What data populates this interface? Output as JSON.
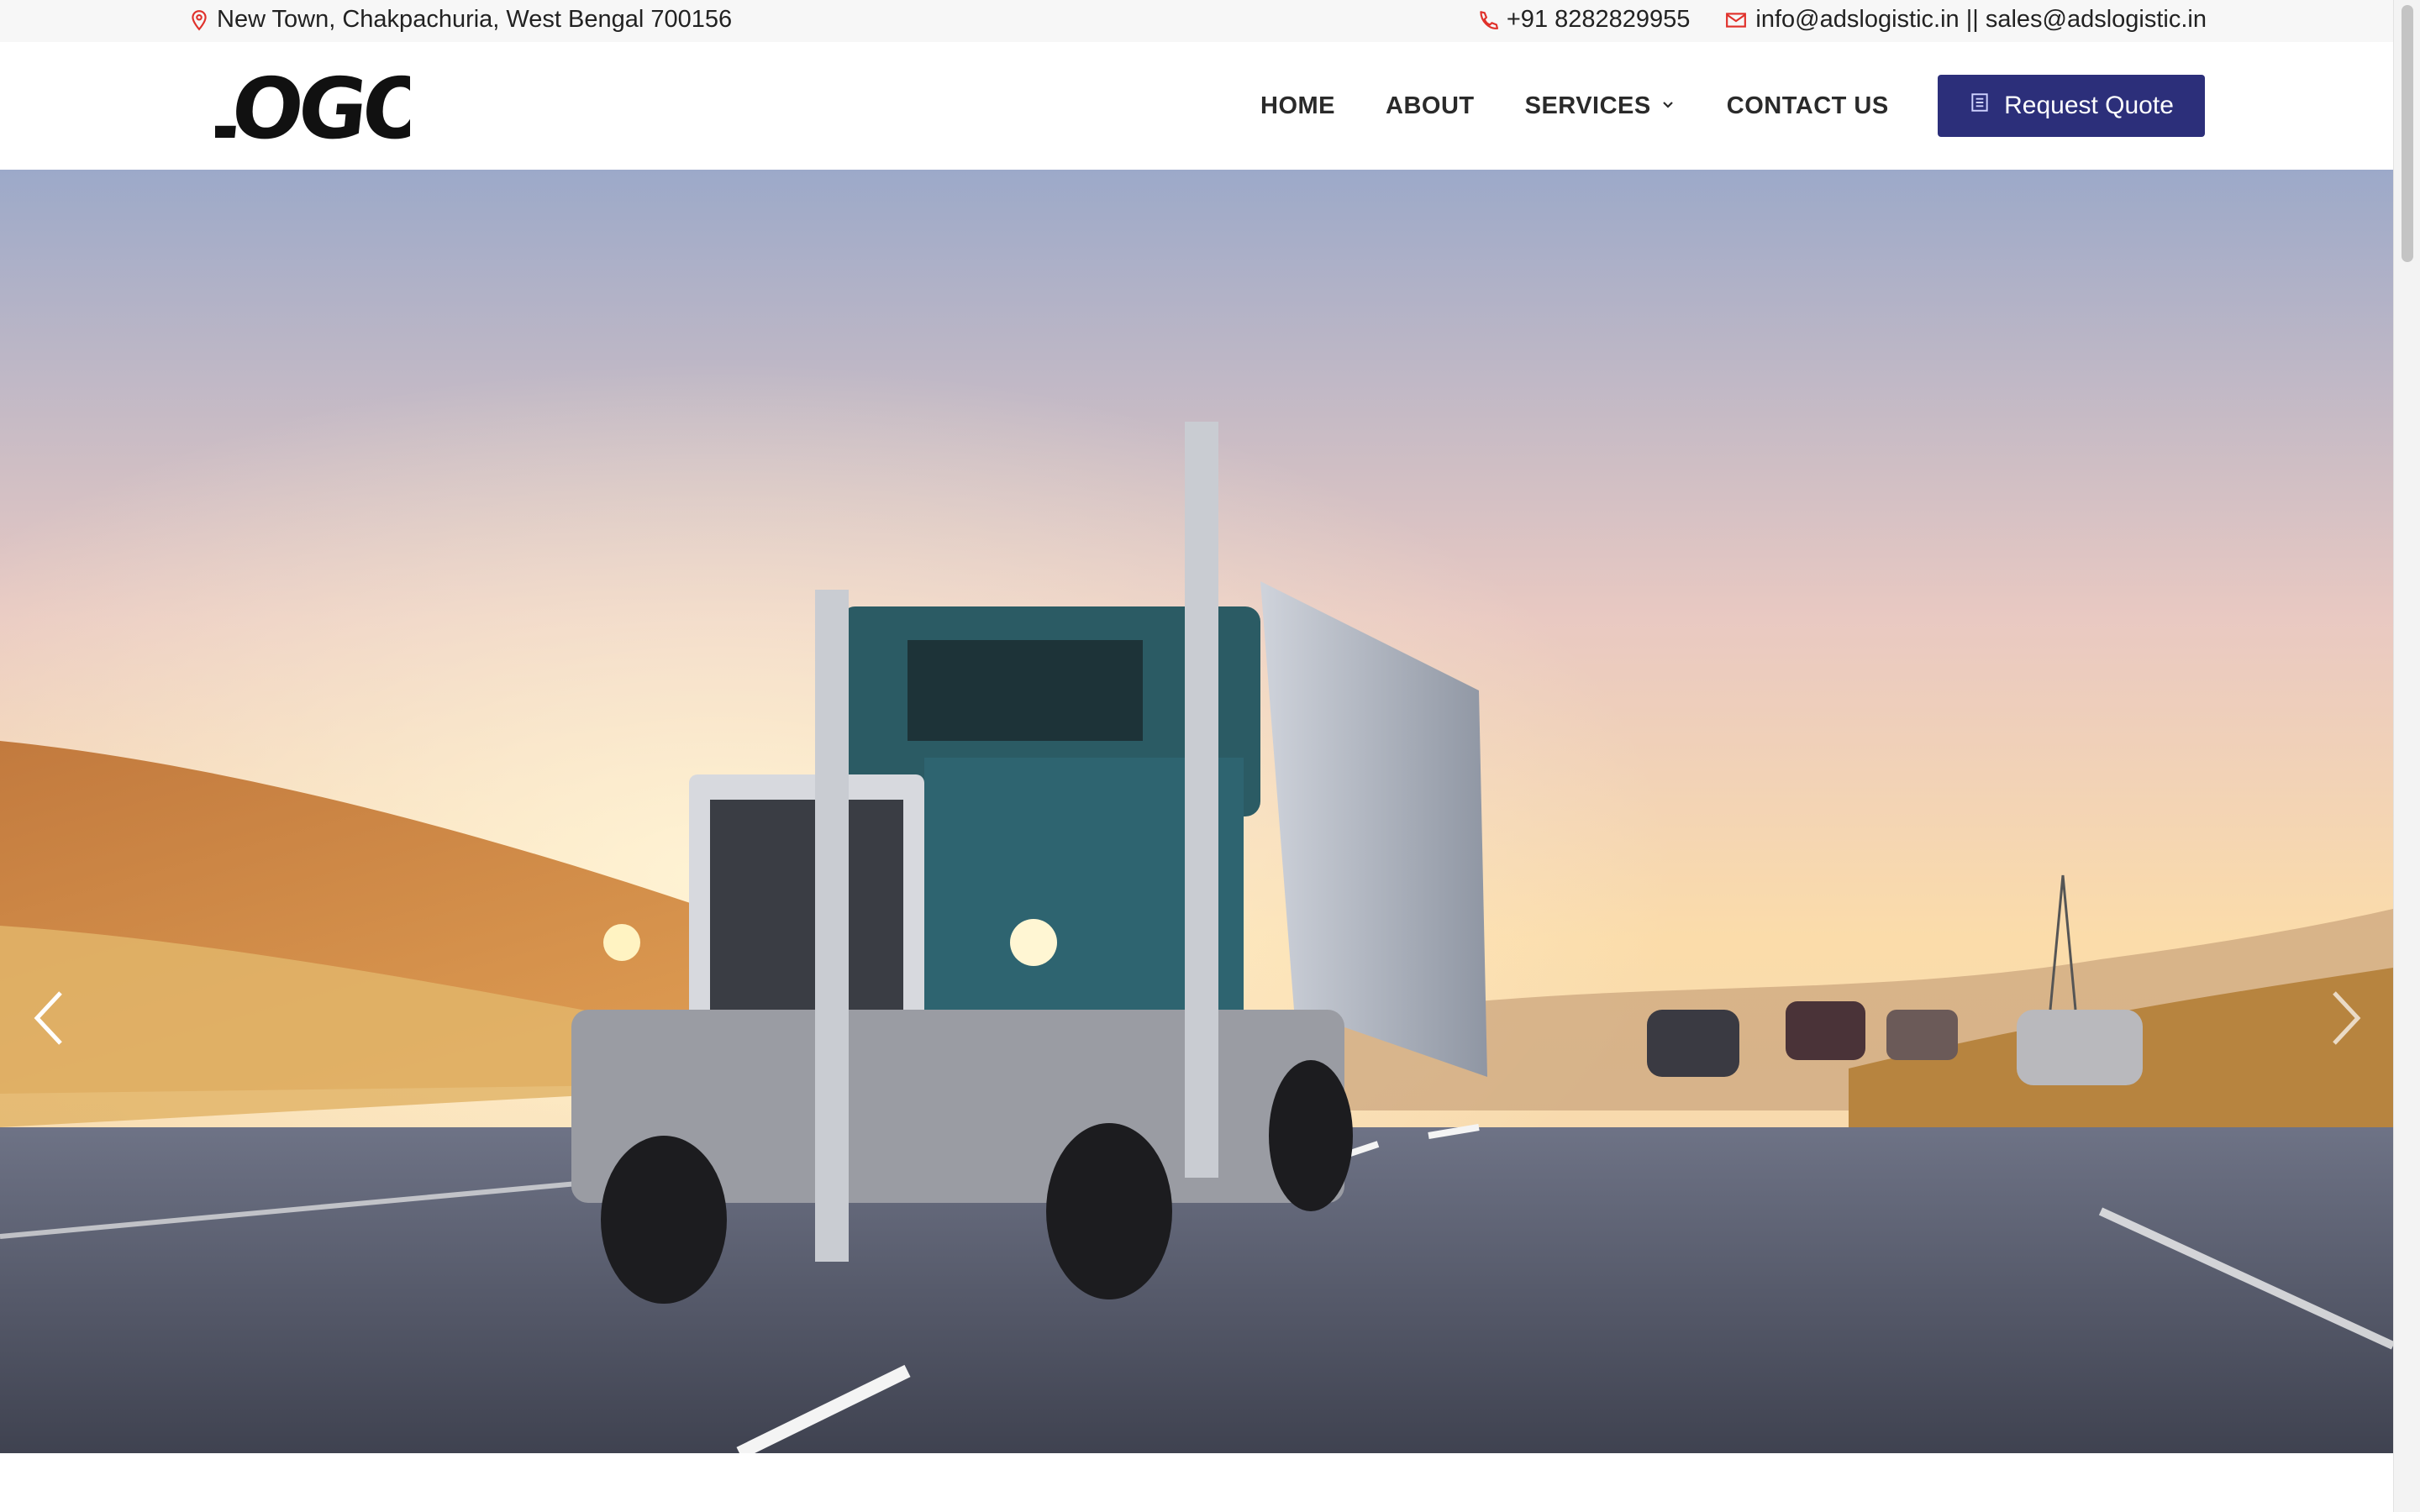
{
  "topbar": {
    "address": "New Town, Chakpachuria, West Bengal 700156",
    "phone": "+91 8282829955",
    "emails": "info@adslogistic.in || sales@adslogistic.in",
    "icons": [
      "location-icon",
      "phone-icon",
      "mail-icon"
    ],
    "icon_color": "#e0312b"
  },
  "header": {
    "logo_text": "LOGO",
    "nav": [
      {
        "label": "HOME"
      },
      {
        "label": "ABOUT"
      },
      {
        "label": "SERVICES",
        "has_dropdown": true
      },
      {
        "label": "CONTACT US"
      }
    ],
    "quote_button": "Request Quote",
    "accent_color": "#2c2f7a"
  },
  "hero": {
    "slide_controls": [
      "previous-slide",
      "next-slide"
    ]
  }
}
